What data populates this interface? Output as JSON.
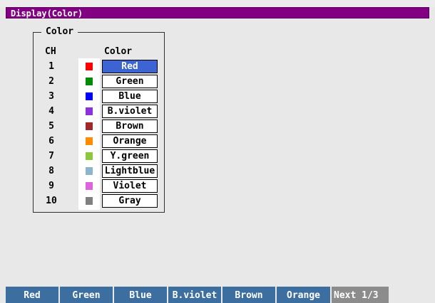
{
  "window": {
    "title": "Display(Color)"
  },
  "group": {
    "title": "Color",
    "ch_header": "CH",
    "color_header": "Color"
  },
  "channels": [
    {
      "ch": "1",
      "color_name": "Red",
      "swatch": "#ff0000",
      "selected": true
    },
    {
      "ch": "2",
      "color_name": "Green",
      "swatch": "#008c00",
      "selected": false
    },
    {
      "ch": "3",
      "color_name": "Blue",
      "swatch": "#0000ff",
      "selected": false
    },
    {
      "ch": "4",
      "color_name": "B.violet",
      "swatch": "#8c32dc",
      "selected": false
    },
    {
      "ch": "5",
      "color_name": "Brown",
      "swatch": "#a02828",
      "selected": false
    },
    {
      "ch": "6",
      "color_name": "Orange",
      "swatch": "#ff8c00",
      "selected": false
    },
    {
      "ch": "7",
      "color_name": "Y.green",
      "swatch": "#8cc83c",
      "selected": false
    },
    {
      "ch": "8",
      "color_name": "Lightblue",
      "swatch": "#8cb4cd",
      "selected": false
    },
    {
      "ch": "9",
      "color_name": "Violet",
      "swatch": "#dc64dc",
      "selected": false
    },
    {
      "ch": "10",
      "color_name": "Gray",
      "swatch": "#808080",
      "selected": false
    }
  ],
  "softkeys": [
    {
      "label": "Red"
    },
    {
      "label": "Green"
    },
    {
      "label": "Blue"
    },
    {
      "label": "B.violet"
    },
    {
      "label": "Brown"
    },
    {
      "label": "Orange"
    },
    {
      "label": "Next 1/3"
    }
  ],
  "colors": {
    "title_bar": "#820082",
    "selected_highlight": "#3c64d2",
    "softkey": "#3c6ea0",
    "softkey_next": "#8c8c8c"
  }
}
